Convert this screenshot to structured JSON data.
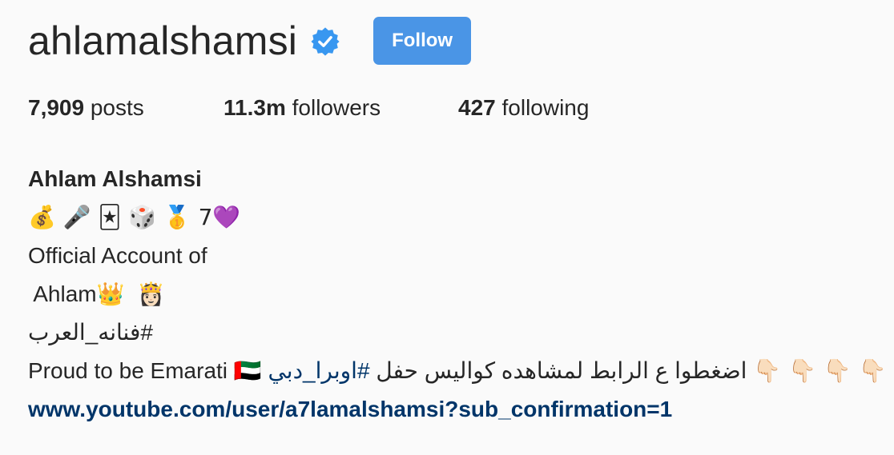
{
  "profile": {
    "username": "ahlamalshamsi",
    "verified_icon": "verified-badge-icon",
    "follow_label": "Follow",
    "accent_color": "#4a95e6"
  },
  "stats": {
    "posts_count": "7,909",
    "posts_label": " posts",
    "followers_count": "11.3m",
    "followers_label": " followers",
    "following_count": "427",
    "following_label": " following"
  },
  "bio": {
    "name": "Ahlam Alshamsi",
    "emoji_line": "💰 🎤 🃏 🎲 🥇 7💜",
    "line_official": "Official Account of",
    "line_ahlam": " Ahlam👑  👸🏻",
    "line_hashtag": "#فنانه_العرب",
    "line_proud": "Proud to be Emarati 🇦🇪",
    "line_hashtag_link": "#اوبرا_دبي",
    "line_arabic_text": "اضغطوا ع الرابط لمشاهده كواليس حفل",
    "line_pointing": "👇🏻 👇🏻 👇🏻 👇🏻 👇🏻",
    "website": "www.youtube.com/user/a7lamalshamsi?sub_confirmation=1",
    "link_color": "#003569"
  }
}
